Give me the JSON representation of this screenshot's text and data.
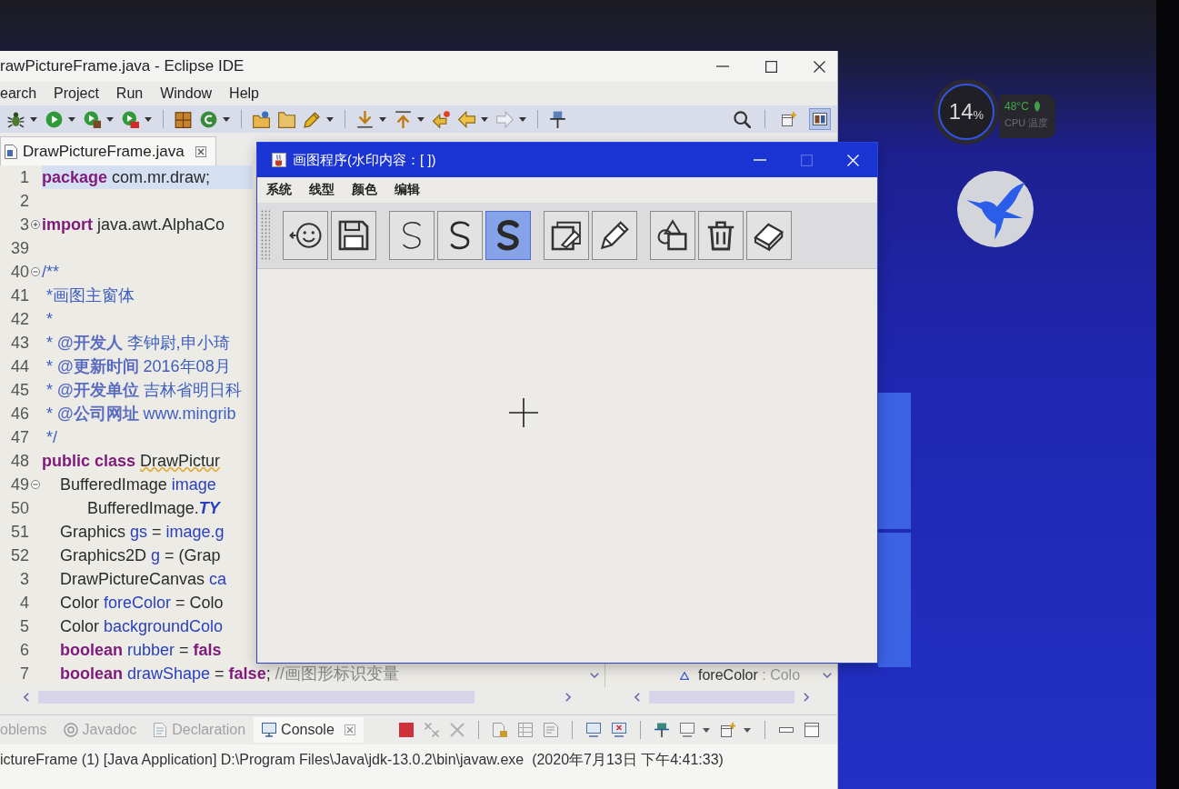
{
  "desktop": {
    "cpu_monitor": {
      "usage": "14",
      "unit": "%",
      "temperature": "48°C",
      "label": "CPU 温度"
    }
  },
  "eclipse": {
    "title": "rawPictureFrame.java - Eclipse IDE",
    "menu": [
      "earch",
      "Project",
      "Run",
      "Window",
      "Help"
    ],
    "toolbar": [
      [
        {
          "kind": "debug",
          "dropdown": true,
          "disabled": false
        },
        {
          "kind": "run",
          "dropdown": true,
          "disabled": false
        },
        {
          "kind": "coverage",
          "dropdown": true,
          "disabled": false
        },
        {
          "kind": "external-tools",
          "dropdown": true,
          "disabled": false
        }
      ],
      [
        {
          "kind": "new-package",
          "dropdown": false,
          "disabled": false
        },
        {
          "kind": "new-class",
          "dropdown": true,
          "disabled": false
        }
      ],
      [
        {
          "kind": "open-type",
          "dropdown": false,
          "disabled": false
        },
        {
          "kind": "open-task",
          "dropdown": false,
          "disabled": false
        },
        {
          "kind": "pen",
          "dropdown": true,
          "disabled": false
        }
      ],
      [
        {
          "kind": "next-annotation",
          "dropdown": true,
          "disabled": false
        },
        {
          "kind": "previous-annotation",
          "dropdown": true,
          "disabled": false
        },
        {
          "kind": "last-edit",
          "dropdown": false,
          "disabled": false
        },
        {
          "kind": "back",
          "dropdown": true,
          "disabled": false
        },
        {
          "kind": "forward",
          "dropdown": true,
          "disabled": true
        }
      ],
      [
        {
          "kind": "pin",
          "dropdown": false,
          "disabled": false
        }
      ]
    ],
    "perspectives": [
      {
        "kind": "open",
        "selected": false
      },
      {
        "kind": "java",
        "selected": true
      }
    ],
    "editor_tabs": [
      {
        "label": "DrawPictureFrame.java",
        "selected": true
      }
    ],
    "code": [
      {
        "number": "1",
        "fold_control": false,
        "current": true,
        "segments": [
          {
            "kind": "keyword",
            "text": "package"
          },
          {
            "kind": "plain",
            "text": " com.mr.draw;"
          }
        ]
      },
      {
        "number": "2",
        "fold_control": false,
        "current": false
      },
      {
        "number": "3",
        "fold_control": true,
        "collapsed": true,
        "current": false,
        "segments": [
          {
            "kind": "keyword",
            "text": "import"
          },
          {
            "kind": "plain",
            "text": " java.awt.AlphaCo"
          }
        ]
      },
      {
        "number": "39",
        "fold_control": false,
        "current": false
      },
      {
        "number": "40",
        "fold_control": true,
        "collapsed": false,
        "current": false,
        "segments": [
          {
            "kind": "doc",
            "text": "/**"
          }
        ]
      },
      {
        "number": "41",
        "fold_control": false,
        "current": false,
        "segments": [
          {
            "kind": "doc",
            "text": " *画图主窗体"
          }
        ]
      },
      {
        "number": "42",
        "fold_control": false,
        "current": false,
        "segments": [
          {
            "kind": "doc",
            "text": " *"
          }
        ]
      },
      {
        "number": "43",
        "fold_control": false,
        "current": false,
        "segments": [
          {
            "kind": "doc",
            "text": " * "
          },
          {
            "kind": "doctag",
            "text": "@开发人"
          },
          {
            "kind": "doc",
            "text": " 李钟尉,申小琦"
          }
        ]
      },
      {
        "number": "44",
        "fold_control": false,
        "current": false,
        "segments": [
          {
            "kind": "doc",
            "text": " * "
          },
          {
            "kind": "doctag",
            "text": "@更新时间"
          },
          {
            "kind": "doc",
            "text": " 2016年08月"
          }
        ]
      },
      {
        "number": "45",
        "fold_control": false,
        "current": false,
        "segments": [
          {
            "kind": "doc",
            "text": " * "
          },
          {
            "kind": "doctag",
            "text": "@开发单位"
          },
          {
            "kind": "doc",
            "text": " 吉林省明日科"
          }
        ]
      },
      {
        "number": "46",
        "fold_control": false,
        "current": false,
        "segments": [
          {
            "kind": "doc",
            "text": " * "
          },
          {
            "kind": "doctag",
            "text": "@公司网址"
          },
          {
            "kind": "doc",
            "text": " www.mingrib"
          }
        ]
      },
      {
        "number": "47",
        "fold_control": false,
        "current": false,
        "segments": [
          {
            "kind": "doc",
            "text": " */"
          }
        ]
      },
      {
        "number": "48",
        "fold_control": false,
        "current": false,
        "segments": [
          {
            "kind": "keyword",
            "text": "public class "
          },
          {
            "kind": "warning",
            "text": "DrawPictur"
          }
        ]
      },
      {
        "number": "49",
        "fold_control": true,
        "collapsed": false,
        "current": false,
        "segments": [
          {
            "kind": "plain",
            "text": "    BufferedImage "
          },
          {
            "kind": "field",
            "text": "image"
          }
        ]
      },
      {
        "number": "50",
        "fold_control": false,
        "current": false,
        "segments": [
          {
            "kind": "plain",
            "text": "          BufferedImage."
          },
          {
            "kind": "static",
            "text": "TY"
          }
        ]
      },
      {
        "number": "51",
        "fold_control": false,
        "current": false,
        "segments": [
          {
            "kind": "plain",
            "text": "    Graphics "
          },
          {
            "kind": "field",
            "text": "gs"
          },
          {
            "kind": "plain",
            "text": " = "
          },
          {
            "kind": "field",
            "text": "image.g"
          }
        ]
      },
      {
        "number": "52",
        "fold_control": false,
        "current": false,
        "segments": [
          {
            "kind": "plain",
            "text": "    Graphics2D "
          },
          {
            "kind": "field",
            "text": "g"
          },
          {
            "kind": "plain",
            "text": " = (Grap"
          }
        ]
      },
      {
        "number": "3",
        "fold_control": false,
        "current": false,
        "segments": [
          {
            "kind": "plain",
            "text": "    DrawPictureCanvas "
          },
          {
            "kind": "field",
            "text": "ca"
          }
        ]
      },
      {
        "number": "4",
        "fold_control": false,
        "current": false,
        "segments": [
          {
            "kind": "plain",
            "text": "    Color "
          },
          {
            "kind": "field",
            "text": "foreColor"
          },
          {
            "kind": "plain",
            "text": " = Colo"
          }
        ]
      },
      {
        "number": "5",
        "fold_control": false,
        "current": false,
        "segments": [
          {
            "kind": "plain",
            "text": "    Color "
          },
          {
            "kind": "field",
            "text": "backgroundColo"
          }
        ]
      },
      {
        "number": "6",
        "fold_control": false,
        "current": false,
        "segments": [
          {
            "kind": "keyword",
            "text": "    boolean"
          },
          {
            "kind": "field",
            "text": " rubber"
          },
          {
            "kind": "plain",
            "text": " = "
          },
          {
            "kind": "keyword",
            "text": "fals"
          }
        ]
      },
      {
        "number": "7",
        "fold_control": false,
        "current": false,
        "segments": [
          {
            "kind": "keyword",
            "text": "    boolean"
          },
          {
            "kind": "field",
            "text": " drawShape"
          },
          {
            "kind": "plain",
            "text": " = "
          },
          {
            "kind": "keyword",
            "text": "false"
          },
          {
            "kind": "plain",
            "text": ";"
          },
          {
            "kind": "comment",
            "text": " //画图形标识变量"
          }
        ]
      }
    ],
    "outline": [
      {
        "name": "foreColor",
        "type": ": Colo"
      }
    ],
    "panel_tabs": [
      {
        "kind": "problems",
        "label": "oblems",
        "selected": false
      },
      {
        "kind": "javadoc",
        "label": "Javadoc",
        "selected": false
      },
      {
        "kind": "declaration",
        "label": "Declaration",
        "selected": false
      },
      {
        "kind": "console",
        "label": "Console",
        "selected": true
      }
    ],
    "console_toolbar": [
      [
        {
          "kind": "terminate",
          "dropdown": false
        },
        {
          "kind": "remove-all",
          "dropdown": false
        },
        {
          "kind": "remove",
          "dropdown": false
        }
      ],
      [
        {
          "kind": "scroll-lock",
          "dropdown": false
        },
        {
          "kind": "clear",
          "dropdown": false
        },
        {
          "kind": "word-wrap",
          "dropdown": false
        }
      ],
      [
        {
          "kind": "show-on-output",
          "dropdown": false
        },
        {
          "kind": "show-on-error",
          "dropdown": false
        }
      ],
      [
        {
          "kind": "pin",
          "dropdown": false
        },
        {
          "kind": "display-console",
          "dropdown": true
        },
        {
          "kind": "open-console",
          "dropdown": true
        }
      ],
      [
        {
          "kind": "minimize",
          "dropdown": false
        },
        {
          "kind": "maximize",
          "dropdown": false
        }
      ]
    ],
    "console_text": "ictureFrame (1) [Java Application] D:\\Program Files\\Java\\jdk-13.0.2\\bin\\javaw.exe  (2020年7月13日 下午4:41:33)"
  },
  "paint_window": {
    "title": "画图程序(水印内容：[ ])",
    "menu": [
      "系统",
      "线型",
      "颜色",
      "编辑"
    ],
    "tool_groups": [
      [
        {
          "kind": "exit",
          "selected": false
        },
        {
          "kind": "save",
          "selected": false
        }
      ],
      [
        {
          "kind": "stroke-thin",
          "selected": false
        },
        {
          "kind": "stroke-medium",
          "selected": false
        },
        {
          "kind": "stroke-thick",
          "selected": true
        }
      ],
      [
        {
          "kind": "background-color",
          "selected": false
        },
        {
          "kind": "foreground-color",
          "selected": false
        }
      ],
      [
        {
          "kind": "shapes",
          "selected": false
        },
        {
          "kind": "clear",
          "selected": false
        },
        {
          "kind": "eraser",
          "selected": false
        }
      ]
    ]
  }
}
